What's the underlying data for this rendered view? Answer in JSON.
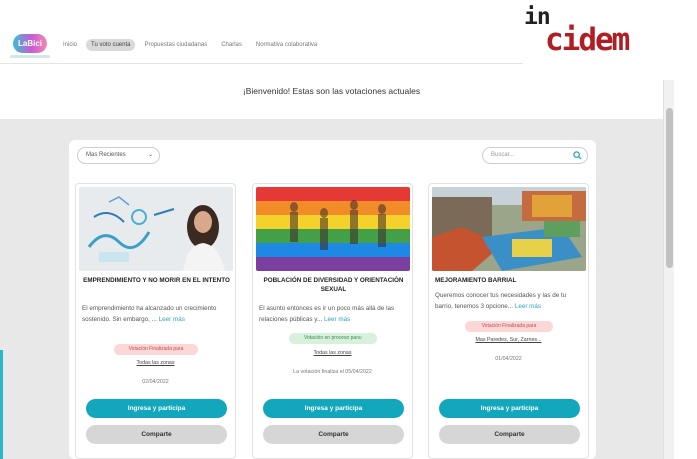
{
  "nav": {
    "logo_text": "LaBici",
    "links": [
      {
        "label": "Inicio",
        "active": false
      },
      {
        "label": "Tu voto cuenta",
        "active": true
      },
      {
        "label": "Propuestas ciudadanas",
        "active": false
      },
      {
        "label": "Charlas",
        "active": false
      },
      {
        "label": "Normativa colaborativa",
        "active": false
      }
    ]
  },
  "brand": {
    "prefix": "in",
    "word": "cidem",
    "color": "#b01e24"
  },
  "welcome": "¡Bienvenido! Estas son las votaciones actuales",
  "filters": {
    "sort_value": "Mas Recientes",
    "search_placeholder": "Buscar..."
  },
  "cards": [
    {
      "title": "EMPRENDIMIENTO Y NO MORIR EN EL INTENTO",
      "desc": "El emprendimiento ha alcanzado un crecimiento sostenido. Sin embargo, ...",
      "more": "Leer más",
      "status": "Votación Finalizada para",
      "zone": "Todas las zonas",
      "date": "02/04/2022",
      "primary_btn": "Ingresa y participa",
      "share_btn": "Comparte"
    },
    {
      "title": "POBLACIÓN DE DIVERSIDAD Y ORIENTACIÓN SEXUAL",
      "desc": "El asunto entonces es ir un poco más allá de las relaciones públicas y...",
      "more": "Leer más",
      "status": "Votación en proceso para:",
      "zone": "Todas las zonas",
      "date": "La votación finaliza el 05/04/2022",
      "primary_btn": "Ingresa y participa",
      "share_btn": "Comparte"
    },
    {
      "title": "MEJORAMIENTO BARRIAL",
      "desc": "Queremos conocer tus necesidades y las de tu barrio, tenemos 3 opcione...",
      "more": "Leer más",
      "status": "Votación Finalizada para",
      "zone": "Mas Paredes, Sur, Zarnes...",
      "date": "01/04/2022",
      "primary_btn": "Ingresa y participa",
      "share_btn": "Comparte"
    }
  ]
}
